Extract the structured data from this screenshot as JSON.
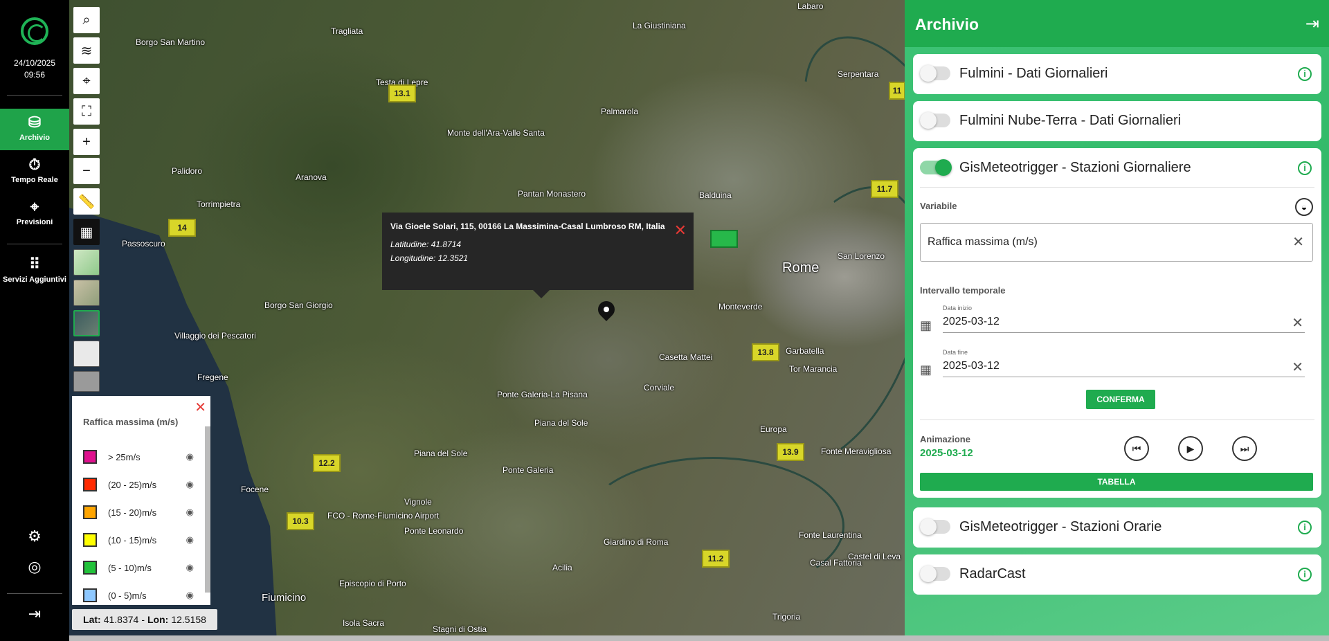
{
  "rail": {
    "date": "24/10/2025",
    "time": "09:56",
    "items": [
      {
        "label": "Archivio",
        "icon": "archive-icon",
        "glyph": "⛁"
      },
      {
        "label": "Tempo Reale",
        "icon": "stopwatch-icon",
        "glyph": "⏱"
      },
      {
        "label": "Previsioni",
        "icon": "binoculars-icon",
        "glyph": "⌖"
      },
      {
        "label": "Servizi Aggiuntivi",
        "icon": "apps-grid-icon",
        "glyph": "⠿"
      }
    ]
  },
  "map": {
    "labels": [
      "Borgo San Martino",
      "Tragliata",
      "Testa di Lepre",
      "La Giustiniana",
      "Labaro",
      "Serpentara",
      "Palmarola",
      "Monte dell'Ara-Valle Santa",
      "Palidoro",
      "Aranova",
      "Torrimpietra",
      "Pantan Monastero",
      "Balduina",
      "Passoscuro",
      "Rome",
      "San Lorenzo",
      "Monteverde",
      "Borgo San Giorgio",
      "Villaggio dei Pescatori",
      "Casetta Mattei",
      "Garbatella",
      "Tor Marancia",
      "Fregene",
      "Ponte Galeria-La Pisana",
      "Piana del Sole",
      "Corviale",
      "Europa",
      "Fonte Meravigliosa",
      "Focene",
      "Piana del Sole",
      "Ponte Galeria",
      "Vignole",
      "FCO - Rome-Fiumicino Airport",
      "Ponte Leonardo",
      "Giardino di Roma",
      "Acilia",
      "Fonte Laurentina",
      "Casal Fattoria",
      "Castel di Leva",
      "Fiumicino",
      "Episcopio di Porto",
      "Isola Sacra",
      "Stagni di Ostia",
      "Trigoria"
    ],
    "station_values": [
      "13.1",
      "14",
      "12.2",
      "10.3",
      "11.7",
      "13.8",
      "13.9",
      "11.2",
      "11"
    ],
    "popup": {
      "address": "Via Gioele Solari, 115, 00166 La Massimina-Casal Lumbroso RM, Italia",
      "latitude": "Latitudine: 41.8714",
      "longitude": "Longitudine: 12.3521"
    },
    "coords": {
      "lat_label": "Lat:",
      "lat": "41.8374",
      "lon_label": "Lon:",
      "lon": "12.5158"
    }
  },
  "legend": {
    "title": "Raffica massima (m/s)",
    "entries": [
      {
        "label": "> 25m/s",
        "color": "#e0108e"
      },
      {
        "label": "(20 - 25)m/s",
        "color": "#ff2a00"
      },
      {
        "label": "(15 - 20)m/s",
        "color": "#ffa500"
      },
      {
        "label": "(10 - 15)m/s",
        "color": "#ffff00"
      },
      {
        "label": "(5 - 10)m/s",
        "color": "#22c23a"
      },
      {
        "label": "(0 - 5)m/s",
        "color": "#8ec8ff"
      }
    ]
  },
  "panel": {
    "title": "Archivio",
    "layers": [
      {
        "label": "Fulmini - Dati Giornalieri",
        "on": false
      },
      {
        "label": "Fulmini Nube-Terra - Dati Giornalieri",
        "on": false
      },
      {
        "label": "GisMeteotrigger - Stazioni Giornaliere",
        "on": true
      },
      {
        "label": "GisMeteotrigger - Stazioni Orarie",
        "on": false
      },
      {
        "label": "RadarCast",
        "on": false
      }
    ],
    "variable_label": "Variabile",
    "variable_value": "Raffica massima (m/s)",
    "interval_label": "Intervallo temporale",
    "start_caption": "Data inizio",
    "start_value": "2025-03-12",
    "end_caption": "Data fine",
    "end_value": "2025-03-12",
    "confirm_label": "CONFERMA",
    "animation_label": "Animazione",
    "animation_date": "2025-03-12",
    "table_label": "TABELLA"
  }
}
